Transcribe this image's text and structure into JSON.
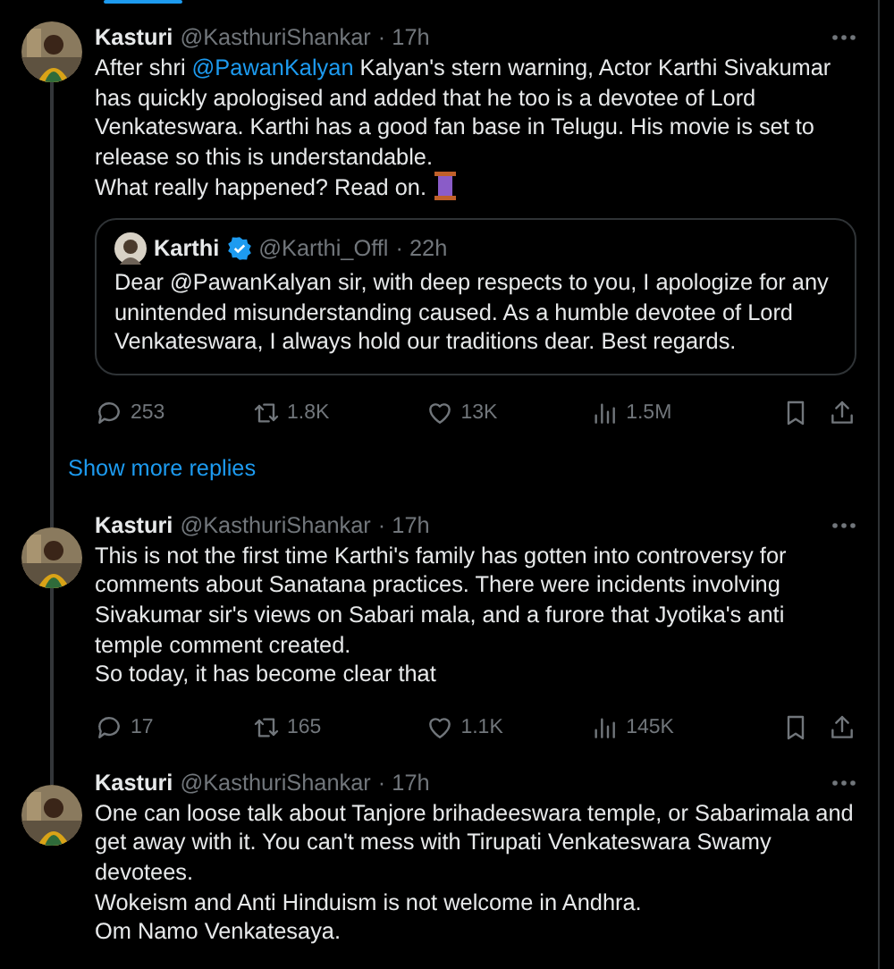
{
  "tweets": [
    {
      "name": "Kasturi",
      "handle": "@KasthuriShankar",
      "time": "· 17h",
      "thread_above": false,
      "thread_below": true,
      "thread_emoji": true,
      "body": [
        {
          "kind": "text",
          "text": "After shri "
        },
        {
          "kind": "mention",
          "text": "@PawanKalyan"
        },
        {
          "kind": "text",
          "text": " Kalyan's stern warning, Actor Karthi Sivakumar has quickly apologised and added that he too is a devotee of Lord Venkateswara. Karthi has a good fan base in Telugu. His movie is set to release so this is understandable.\nWhat really happened? Read on."
        }
      ],
      "quote": {
        "name": "Karthi",
        "verified": true,
        "handle": "@Karthi_Offl",
        "time": "· 22h",
        "body": "Dear @PawanKalyan sir, with deep respects to you, I apologize for any unintended misunderstanding caused. As a humble devotee of Lord Venkateswara, I always hold our traditions dear. Best regards."
      },
      "stats": {
        "replies": "253",
        "reposts": "1.8K",
        "likes": "13K",
        "views": "1.5M"
      },
      "show_more": "Show more replies"
    },
    {
      "name": "Kasturi",
      "handle": "@KasthuriShankar",
      "time": "· 17h",
      "thread_above": true,
      "thread_below": true,
      "thread_emoji": false,
      "body": [
        {
          "kind": "text",
          "text": "This is not the first time Karthi's family has gotten into controversy for comments about Sanatana practices. There were incidents involving Sivakumar sir's views on Sabari mala, and a furore that Jyotika's anti temple comment created.\nSo today, it has become clear that"
        }
      ],
      "stats": {
        "replies": "17",
        "reposts": "165",
        "likes": "1.1K",
        "views": "145K"
      }
    },
    {
      "name": "Kasturi",
      "handle": "@KasthuriShankar",
      "time": "· 17h",
      "thread_above": true,
      "thread_below": false,
      "thread_emoji": false,
      "body": [
        {
          "kind": "text",
          "text": "One can loose talk about Tanjore brihadeeswara temple, or Sabarimala and get away with it. You can't mess with Tirupati Venkateswara Swamy devotees.\nWokeism and Anti Hinduism is not welcome in Andhra.\nOm Namo Venkatesaya."
        }
      ]
    }
  ]
}
